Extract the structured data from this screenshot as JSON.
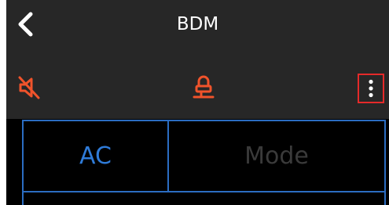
{
  "header": {
    "title": "BDM",
    "background": "#272727",
    "back_icon": "chevron-left-icon"
  },
  "toolbar": {
    "mute_icon": "speaker-muted-icon",
    "clear_icon": "eraser-icon",
    "more_icon": "vertical-ellipsis-icon",
    "icon_color": "#f0532b",
    "highlight_color": "#e52a2a"
  },
  "tabs": {
    "border_color": "#2b6dc2",
    "items": [
      {
        "label": "AC",
        "active": true,
        "color": "#2f7bd8"
      },
      {
        "label": "Mode",
        "active": false,
        "color": "#3a3a3a"
      }
    ]
  }
}
